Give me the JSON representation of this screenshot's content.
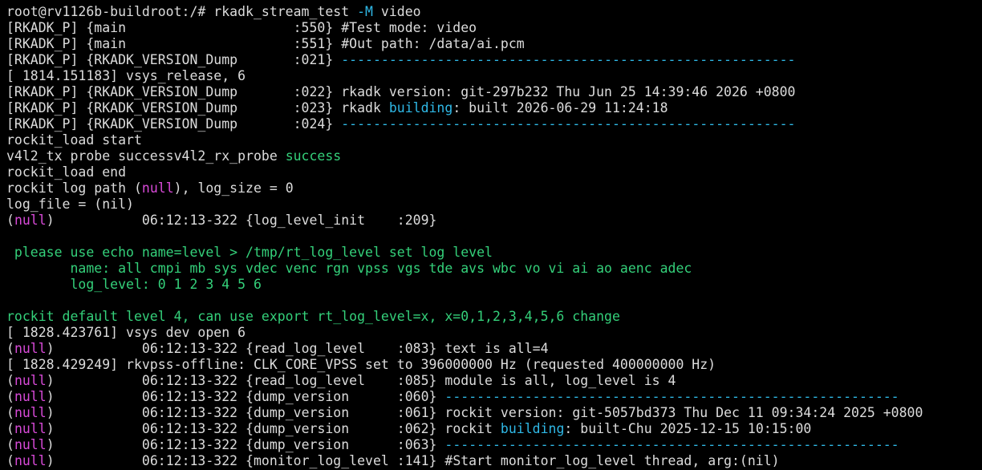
{
  "window": {
    "type": "terminal"
  },
  "colors": {
    "background": "#000000",
    "default_text": "#dcdcdc",
    "cyan": "#2fb8e6",
    "green": "#34d07a",
    "magenta": "#d84ad8"
  },
  "top_partial_line": "rv1126b",
  "lines": [
    [
      [
        "w",
        "root@rv1126b-buildroot:/# rkadk_stream_test "
      ],
      [
        "c",
        "-M"
      ],
      [
        "w",
        " video"
      ]
    ],
    [
      [
        "w",
        "[RKADK_P] {main                     :550} #Test mode: video"
      ]
    ],
    [
      [
        "w",
        "[RKADK_P] {main                     :551} #Out path: /data/ai.pcm"
      ]
    ],
    [
      [
        "w",
        "[RKADK_P] {RKADK_VERSION_Dump       :021} "
      ],
      [
        "c",
        "---------------------------------------------------------"
      ]
    ],
    [
      [
        "w",
        "[ 1814.151183] vsys_release, 6"
      ]
    ],
    [
      [
        "w",
        "[RKADK_P] {RKADK_VERSION_Dump       :022} rkadk version: git-297b232 Thu Jun 25 14:39:46 2026 +0800"
      ]
    ],
    [
      [
        "w",
        "[RKADK_P] {RKADK_VERSION_Dump       :023} rkadk "
      ],
      [
        "c",
        "building"
      ],
      [
        "w",
        ": built 2026-06-29 11:24:18"
      ]
    ],
    [
      [
        "w",
        "[RKADK_P] {RKADK_VERSION_Dump       :024} "
      ],
      [
        "c",
        "---------------------------------------------------------"
      ]
    ],
    [
      [
        "w",
        "rockit_load start"
      ]
    ],
    [
      [
        "w",
        "v4l2_tx probe successv4l2_rx_probe "
      ],
      [
        "g",
        "success"
      ]
    ],
    [
      [
        "w",
        "rockit_load end"
      ]
    ],
    [
      [
        "w",
        "rockit log path "
      ],
      [
        "w",
        "("
      ],
      [
        "m",
        "null"
      ],
      [
        "w",
        "), log_size = 0"
      ]
    ],
    [
      [
        "w",
        "log_file = (nil)"
      ]
    ],
    [
      [
        "w",
        "("
      ],
      [
        "m",
        "null"
      ],
      [
        "w",
        ")           06:12:13-322 {log_level_init    :209}"
      ]
    ],
    [
      [
        "w",
        ""
      ]
    ],
    [
      [
        "g",
        " please use echo name=level > /tmp/rt_log_level set log level"
      ]
    ],
    [
      [
        "g",
        "        name: all cmpi mb sys vdec venc rgn vpss vgs tde avs wbc vo vi ai ao aenc adec"
      ]
    ],
    [
      [
        "g",
        "        log_level: 0 1 2 3 4 5 6"
      ]
    ],
    [
      [
        "w",
        ""
      ]
    ],
    [
      [
        "g",
        "rockit default level 4, can use export rt_log_level=x, x=0,1,2,3,4,5,6 change"
      ]
    ],
    [
      [
        "w",
        "[ 1828.423761] vsys dev open 6"
      ]
    ],
    [
      [
        "w",
        "("
      ],
      [
        "m",
        "null"
      ],
      [
        "w",
        ")           06:12:13-322 {read_log_level    :083} text is all=4"
      ]
    ],
    [
      [
        "w",
        "[ 1828.429249] rkvpss-offline: CLK_CORE_VPSS set to 396000000 Hz (requested 400000000 Hz)"
      ]
    ],
    [
      [
        "w",
        "("
      ],
      [
        "m",
        "null"
      ],
      [
        "w",
        ")           06:12:13-322 {read_log_level    :085} module is all, log_level is 4"
      ]
    ],
    [
      [
        "w",
        "("
      ],
      [
        "m",
        "null"
      ],
      [
        "w",
        ")           06:12:13-322 {dump_version      :060} "
      ],
      [
        "c",
        "---------------------------------------------------------"
      ]
    ],
    [
      [
        "w",
        "("
      ],
      [
        "m",
        "null"
      ],
      [
        "w",
        ")           06:12:13-322 {dump_version      :061} rockit version: git-5057bd373 Thu Dec 11 09:34:24 2025 +0800"
      ]
    ],
    [
      [
        "w",
        "("
      ],
      [
        "m",
        "null"
      ],
      [
        "w",
        ")           06:12:13-322 {dump_version      :062} rockit "
      ],
      [
        "c",
        "building"
      ],
      [
        "w",
        ": built-Chu 2025-12-15 10:15:00"
      ]
    ],
    [
      [
        "w",
        "("
      ],
      [
        "m",
        "null"
      ],
      [
        "w",
        ")           06:12:13-322 {dump_version      :063} "
      ],
      [
        "c",
        "---------------------------------------------------------"
      ]
    ],
    [
      [
        "w",
        "("
      ],
      [
        "m",
        "null"
      ],
      [
        "w",
        ")           06:12:13-322 {monitor_log_level :141} #Start monitor_log_level thread, arg:(nil)"
      ]
    ]
  ]
}
